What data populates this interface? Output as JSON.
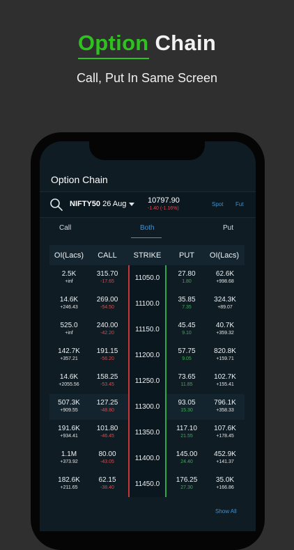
{
  "promo": {
    "title_green": "Option",
    "title_white": "Chain",
    "subtitle": "Call, Put In Same Screen"
  },
  "app": {
    "title": "Option Chain",
    "symbol": "NIFTY50",
    "expiry": "26 Aug",
    "price": "10797.90",
    "change": "-1.40 (-1.16%)",
    "spot_label": "Spot",
    "fut_label": "Fut"
  },
  "tabs": {
    "call": "Call",
    "both": "Both",
    "put": "Put"
  },
  "columns": {
    "oi_left": "OI(Lacs)",
    "call": "CALL",
    "strike": "STRIKE",
    "put": "PUT",
    "oi_right": "OI(Lacs)"
  },
  "rows": [
    {
      "oi_call": "2.5K",
      "oi_call_chg": "+inf",
      "call": "315.70",
      "call_chg": "-17.65",
      "strike": "11050.0",
      "put": "27.80",
      "put_chg": "1.80",
      "oi_put": "62.6K",
      "oi_put_chg": "+998.68"
    },
    {
      "oi_call": "14.6K",
      "oi_call_chg": "+246.43",
      "call": "269.00",
      "call_chg": "-54.50",
      "strike": "11100.0",
      "put": "35.85",
      "put_chg": "7.35",
      "oi_put": "324.3K",
      "oi_put_chg": "+89.07"
    },
    {
      "oi_call": "525.0",
      "oi_call_chg": "+inf",
      "call": "240.00",
      "call_chg": "-42.20",
      "strike": "11150.0",
      "put": "45.45",
      "put_chg": "9.10",
      "oi_put": "40.7K",
      "oi_put_chg": "+359.32"
    },
    {
      "oi_call": "142.7K",
      "oi_call_chg": "+357.21",
      "call": "191.15",
      "call_chg": "-56.20",
      "strike": "11200.0",
      "put": "57.75",
      "put_chg": "9.05",
      "oi_put": "820.8K",
      "oi_put_chg": "+159.71"
    },
    {
      "oi_call": "14.6K",
      "oi_call_chg": "+2055.56",
      "call": "158.25",
      "call_chg": "-53.45",
      "strike": "11250.0",
      "put": "73.65",
      "put_chg": "11.85",
      "oi_put": "102.7K",
      "oi_put_chg": "+155.41"
    },
    {
      "oi_call": "507.3K",
      "oi_call_chg": "+909.55",
      "call": "127.25",
      "call_chg": "-48.80",
      "strike": "11300.0",
      "put": "93.05",
      "put_chg": "15.30",
      "oi_put": "796.1K",
      "oi_put_chg": "+358.33"
    },
    {
      "oi_call": "191.6K",
      "oi_call_chg": "+934.41",
      "call": "101.80",
      "call_chg": "-46.45",
      "strike": "11350.0",
      "put": "117.10",
      "put_chg": "21.55",
      "oi_put": "107.6K",
      "oi_put_chg": "+178.45"
    },
    {
      "oi_call": "1.1M",
      "oi_call_chg": "+373.92",
      "call": "80.00",
      "call_chg": "-43.05",
      "strike": "11400.0",
      "put": "145.00",
      "put_chg": "24.40",
      "oi_put": "452.9K",
      "oi_put_chg": "+141.37"
    },
    {
      "oi_call": "182.6K",
      "oi_call_chg": "+211.65",
      "call": "62.15",
      "call_chg": "-38.40",
      "strike": "11450.0",
      "put": "176.25",
      "put_chg": "27.30",
      "oi_put": "35.0K",
      "oi_put_chg": "+166.86"
    }
  ],
  "footer": {
    "show_all": "Show All"
  },
  "colors": {
    "accent_green": "#2fc11f",
    "link_blue": "#3f92cf",
    "loss_red": "#e0494b",
    "gain_green": "#37b24d",
    "background": "#0f1c24"
  }
}
